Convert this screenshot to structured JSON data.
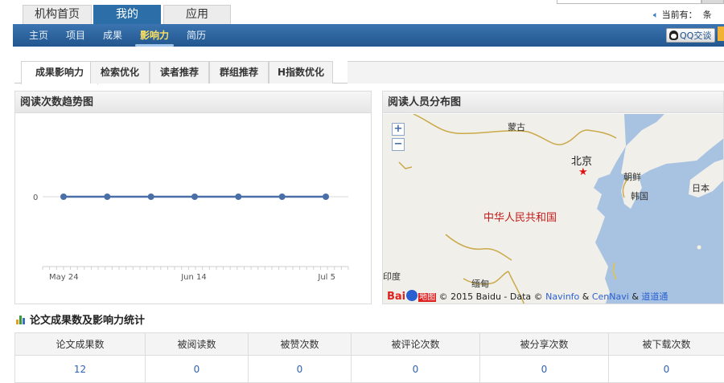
{
  "top_tabs": [
    {
      "label": "机构首页",
      "active": false
    },
    {
      "label": "我的",
      "active": true
    },
    {
      "label": "应用",
      "active": false
    }
  ],
  "notice": {
    "prefix": "当前有：",
    "suffix": "条"
  },
  "nav": {
    "items": [
      {
        "label": "主页",
        "active": false
      },
      {
        "label": "项目",
        "active": false
      },
      {
        "label": "成果",
        "active": false
      },
      {
        "label": "影响力",
        "active": true
      },
      {
        "label": "简历",
        "active": false
      }
    ],
    "qq_label": "QQ交谈"
  },
  "subtabs": [
    {
      "label": "成果影响力",
      "active": true
    },
    {
      "label": "检索优化",
      "active": false
    },
    {
      "label": "读者推荐",
      "active": false
    },
    {
      "label": "群组推荐",
      "active": false
    },
    {
      "label": "H指数优化",
      "active": false
    }
  ],
  "trend_panel": {
    "title": "阅读次数趋势图"
  },
  "map_panel": {
    "title": "阅读人员分布图",
    "zoom_in": "+",
    "zoom_out": "−",
    "labels": {
      "mongolia": "蒙古",
      "beijing": "北京",
      "north_korea": "朝鲜",
      "korea": "韩国",
      "japan": "日本",
      "china": "中华人民共和国",
      "india": "印度",
      "myanmar": "缅甸"
    },
    "copyright": {
      "logo_bai": "Bai",
      "logo_di": "地图",
      "text": "© 2015 Baidu - Data ©",
      "link1": "Navinfo",
      "amp1": "&",
      "link2": "CenNavi",
      "amp2": "&",
      "link3": "道道通"
    }
  },
  "chart_data": {
    "type": "line",
    "title": "",
    "x": [
      "May 24",
      "May 31",
      "Jun 7",
      "Jun 14",
      "Jun 21",
      "Jun 28",
      "Jul 5"
    ],
    "x_tick_labels": [
      "May 24",
      "Jun 14",
      "Jul 5"
    ],
    "series": [
      {
        "values": [
          0,
          0,
          0,
          0,
          0,
          0,
          0
        ],
        "color": "#4a6fa8"
      }
    ],
    "y_tick_labels": [
      "0"
    ],
    "ylim": [
      0,
      1
    ],
    "grid": false,
    "legend": "none"
  },
  "stats": {
    "title": "论文成果数及影响力统计",
    "headers": [
      "论文成果数",
      "被阅读数",
      "被赞次数",
      "被评论次数",
      "被分享次数",
      "被下载次数"
    ],
    "values": [
      "12",
      "0",
      "0",
      "0",
      "0",
      "0"
    ]
  },
  "colors": {
    "nav_blue": "#2c6fa8",
    "active_nav": "#ffe05a",
    "link_blue": "#2f63b5",
    "china_red": "#c31b1b"
  }
}
